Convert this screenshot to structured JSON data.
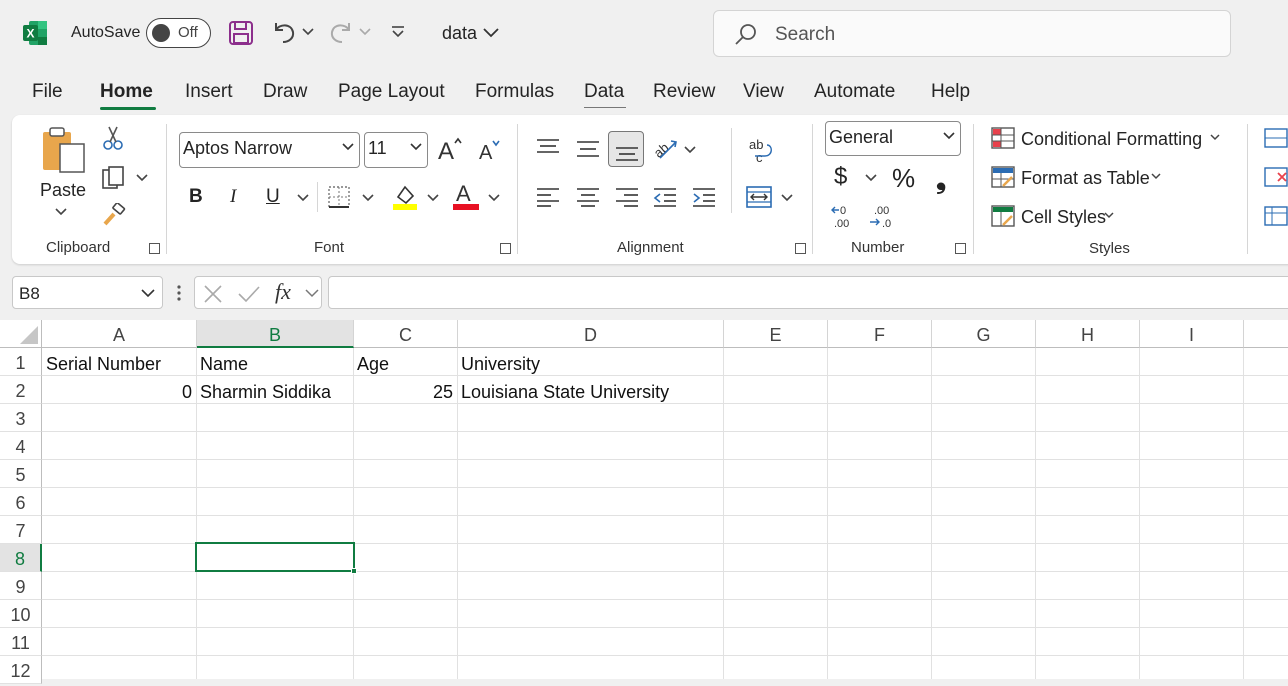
{
  "titlebar": {
    "autosave_label": "AutoSave",
    "autosave_state": "Off",
    "filename": "data",
    "search_placeholder": "Search"
  },
  "menu": {
    "tabs": [
      "File",
      "Home",
      "Insert",
      "Draw",
      "Page Layout",
      "Formulas",
      "Data",
      "Review",
      "View",
      "Automate",
      "Help"
    ],
    "active": "Home"
  },
  "ribbon": {
    "clipboard": {
      "paste_label": "Paste",
      "group_label": "Clipboard"
    },
    "font": {
      "font_name": "Aptos Narrow",
      "font_size": "11",
      "group_label": "Font"
    },
    "alignment": {
      "group_label": "Alignment"
    },
    "number": {
      "format": "General",
      "group_label": "Number"
    },
    "styles": {
      "conditional_formatting": "Conditional Formatting",
      "format_as_table": "Format as Table",
      "cell_styles": "Cell Styles",
      "group_label": "Styles"
    }
  },
  "formula_bar": {
    "name_box": "B8",
    "formula": ""
  },
  "sheet": {
    "columns": [
      "A",
      "B",
      "C",
      "D",
      "E",
      "F",
      "G",
      "H",
      "I"
    ],
    "selected_column": "B",
    "rows": [
      "1",
      "2",
      "3",
      "4",
      "5",
      "6",
      "7",
      "8",
      "9",
      "10",
      "11",
      "12"
    ],
    "selected_row": "8",
    "data": {
      "r1": {
        "a": "Serial Number",
        "b": "Name",
        "c": "Age",
        "d": "University"
      },
      "r2": {
        "a": "0",
        "b": "Sharmin Siddika",
        "c": "25",
        "d": "Louisiana State University"
      }
    }
  },
  "colors": {
    "accent": "#107c41",
    "excel_green": "#107c41",
    "font_color_red": "#e81123",
    "highlight_yellow": "#ffff00"
  }
}
